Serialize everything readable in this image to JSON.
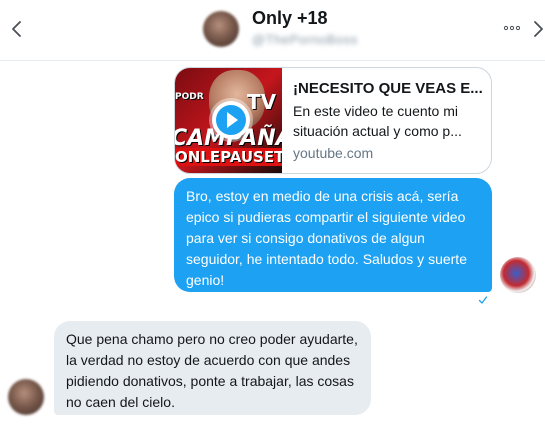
{
  "header": {
    "name": "Only +18",
    "handle": "@ThePornoBoss"
  },
  "link_card": {
    "thumbnail_text": [
      "PODR",
      "TV",
      "CAMPAÑA",
      "ONLEPAUSET"
    ],
    "title": "¡NECESITO QUE VEAS E...",
    "description": [
      "En este video te cuento mi",
      "situación actual y como p..."
    ],
    "domain": "youtube.com"
  },
  "messages": {
    "outgoing": [
      "Bro, estoy en medio de una crisis acá, sería",
      "epico si pudieras compartir el siguiente video",
      "para ver si consigo donativos de algun",
      "seguidor, he intentado todo. Saludos y suerte",
      "genio!"
    ],
    "incoming": [
      "Que pena chamo pero no creo poder ayudarte,",
      "la verdad no estoy de acuerdo con que andes",
      "pidiendo donativos, ponte a trabajar, las cosas",
      "no caen del cielo."
    ]
  },
  "icons": {
    "back": "chevron-left-icon",
    "more": "more-icon",
    "forward": "chevron-right-icon",
    "play": "play-icon",
    "seen": "checkmark-icon"
  },
  "colors": {
    "accent": "#1da1f2",
    "incoming_bubble": "#e6ecf0",
    "secondary_text": "#657786"
  }
}
